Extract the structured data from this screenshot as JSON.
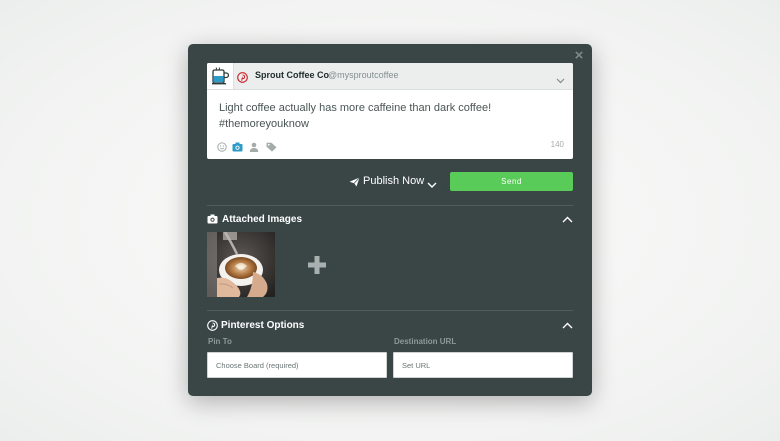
{
  "modal": {
    "close_label": "×"
  },
  "profile": {
    "name": "Sprout Coffee Co",
    "handle": "@mysproutcoffee",
    "network_icon": "pinterest-icon",
    "avatar_icon": "coffee-cup-logo"
  },
  "composer": {
    "message_line1": "Light coffee actually has more caffeine than dark coffee!",
    "message_line2": "#themoreyouknow",
    "char_count": "140",
    "tools": [
      "emoji-icon",
      "camera-icon",
      "user-tag-icon",
      "tag-icon"
    ]
  },
  "actions": {
    "publish_label": "Publish Now",
    "send_label": "Send"
  },
  "attached_images": {
    "title": "Attached Images",
    "add_label": "+"
  },
  "pinterest": {
    "title": "Pinterest Options",
    "pin_to_label": "Pin To",
    "pin_to_placeholder": "Choose Board (required)",
    "destination_label": "Destination URL",
    "destination_placeholder": "Set URL"
  },
  "colors": {
    "modal_bg": "#394645",
    "send_green": "#59cb59",
    "pinterest_red": "#cb2027",
    "accent_blue": "#2e9bc6"
  }
}
